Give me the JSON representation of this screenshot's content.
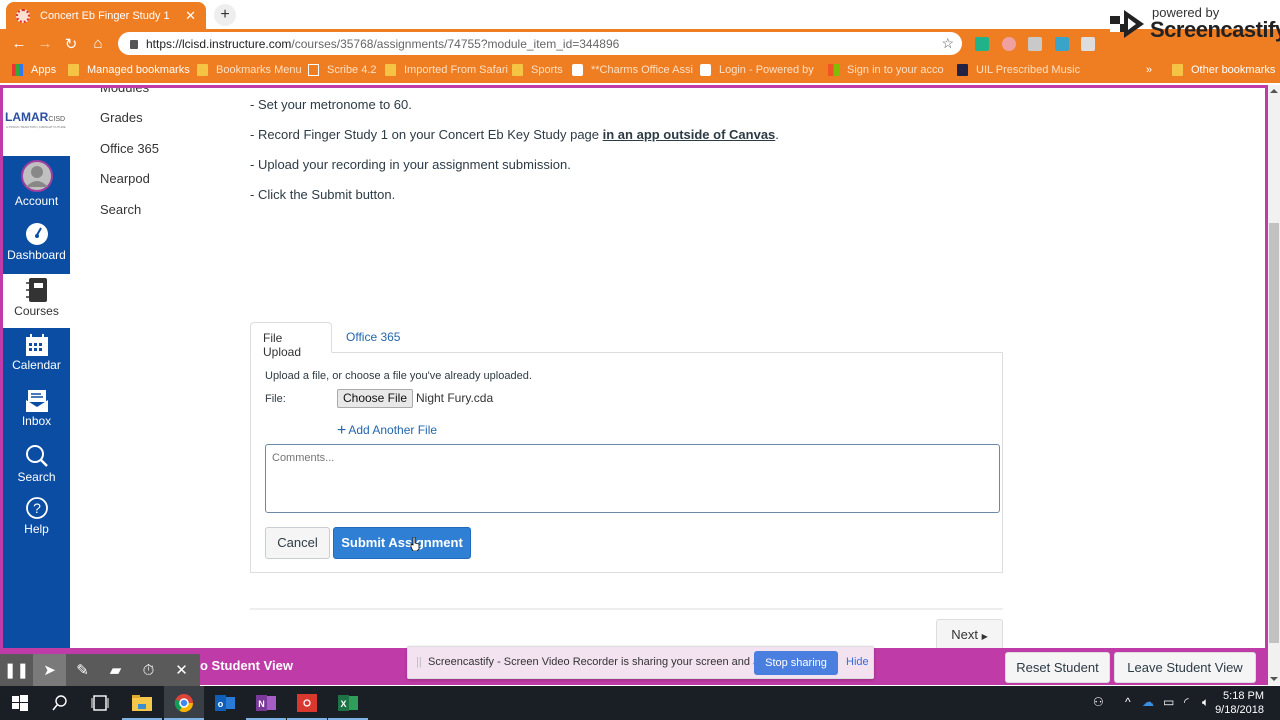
{
  "browser": {
    "tab_title": "Concert Eb Finger Study 1",
    "url_host": "https://lcisd.instructure.com",
    "url_path": "/courses/35768/assignments/74755?module_item_id=344896",
    "accent_color": "#ef7d22",
    "bookmarks": [
      {
        "label": "Apps",
        "icon": "apps-grid-icon"
      },
      {
        "label": "Managed bookmarks",
        "icon": "folder-icon"
      },
      {
        "label": "Bookmarks Menu",
        "icon": "folder-icon"
      },
      {
        "label": "Scribe 4.2",
        "icon": "page-icon"
      },
      {
        "label": "Imported From Safari",
        "icon": "folder-icon"
      },
      {
        "label": "Sports",
        "icon": "folder-icon"
      },
      {
        "label": "**Charms Office Assi",
        "icon": "charms-icon"
      },
      {
        "label": "Login - Powered by",
        "icon": "login-icon"
      },
      {
        "label": "Sign in to your acco",
        "icon": "microsoft-icon"
      },
      {
        "label": "UIL Prescribed Music",
        "icon": "uil-icon"
      }
    ],
    "more_bookmarks": "»",
    "other_bookmarks": "Other bookmarks"
  },
  "watermark": {
    "powered_by": "powered by",
    "brand": "Screencastify"
  },
  "global_nav": {
    "logo_text": "LAMAR",
    "logo_suffix": "CISD",
    "logo_tagline": "A PROUD TRADITION | A BRIGHT FUTURE",
    "items": [
      {
        "label": "Account",
        "icon": "account-avatar-icon"
      },
      {
        "label": "Dashboard",
        "icon": "dashboard-icon"
      },
      {
        "label": "Courses",
        "icon": "courses-icon",
        "active": true
      },
      {
        "label": "Calendar",
        "icon": "calendar-icon"
      },
      {
        "label": "Inbox",
        "icon": "inbox-icon"
      },
      {
        "label": "Search",
        "icon": "search-icon"
      },
      {
        "label": "Help",
        "icon": "help-icon"
      }
    ]
  },
  "course_nav": {
    "items": [
      "Modules",
      "Grades",
      "Office 365",
      "Nearpod",
      "Search"
    ]
  },
  "assignment": {
    "instructions": [
      "- Set your metronome to 60.",
      "- Record Finger Study 1 on your Concert Eb Key Study page ",
      "- Upload your recording in your assignment submission.",
      "- Click the Submit button."
    ],
    "instruction_link": "in an app outside of Canvas",
    "instruction_link_suffix": "."
  },
  "submission": {
    "tabs": [
      "File Upload",
      "Office 365"
    ],
    "active_tab": "File Upload",
    "hint": "Upload a file, or choose a file you've already uploaded.",
    "file_label": "File:",
    "choose_file_label": "Choose File",
    "chosen_file": "Night Fury.cda",
    "add_file_label": "Add Another File",
    "comments_placeholder": "Comments...",
    "comments_value": "",
    "cancel_label": "Cancel",
    "submit_label": "Submit Assignment"
  },
  "pager": {
    "next_label": "Next"
  },
  "student_view": {
    "label": "o Student View",
    "reset_label": "Reset Student",
    "leave_label": "Leave Student View",
    "bar_color": "#bf3ba7"
  },
  "sharing": {
    "message": "Screencastify - Screen Video Recorder is sharing your screen and audio.",
    "stop_label": "Stop sharing",
    "hide_label": "Hide"
  },
  "taskbar": {
    "apps": [
      "windows-start-icon",
      "search-icon",
      "task-view-icon",
      "file-explorer-icon",
      "chrome-icon",
      "outlook-icon",
      "onenote-icon",
      "recorder-icon",
      "excel-icon"
    ],
    "time": "5:18 PM",
    "date": "9/18/2018"
  }
}
